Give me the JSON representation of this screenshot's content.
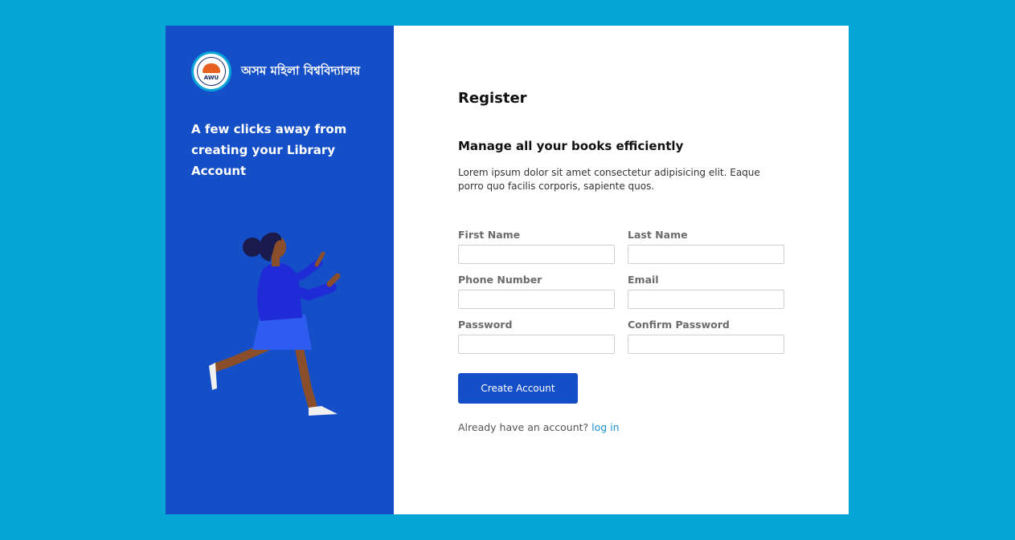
{
  "brand": {
    "name": "অসম মহিলা বিশ্ববিদ্যালয়",
    "logo_text": "AWU"
  },
  "left": {
    "tagline": "A few clicks away from creating your Library Account"
  },
  "main": {
    "title": "Register",
    "subtitle": "Manage all your books efficiently",
    "description": "Lorem ipsum dolor sit amet consectetur adipisicing elit. Eaque porro quo facilis corporis, sapiente quos."
  },
  "form": {
    "first_name_label": "First Name",
    "last_name_label": "Last Name",
    "phone_label": "Phone Number",
    "email_label": "Email",
    "password_label": "Password",
    "confirm_password_label": "Confirm Password",
    "submit_label": "Create Account"
  },
  "footer": {
    "prompt": "Already have an account? ",
    "login_link": "log in"
  },
  "colors": {
    "background": "#05a6d6",
    "panel": "#154fc8",
    "button": "#154fc8",
    "link": "#1a8fd1"
  }
}
